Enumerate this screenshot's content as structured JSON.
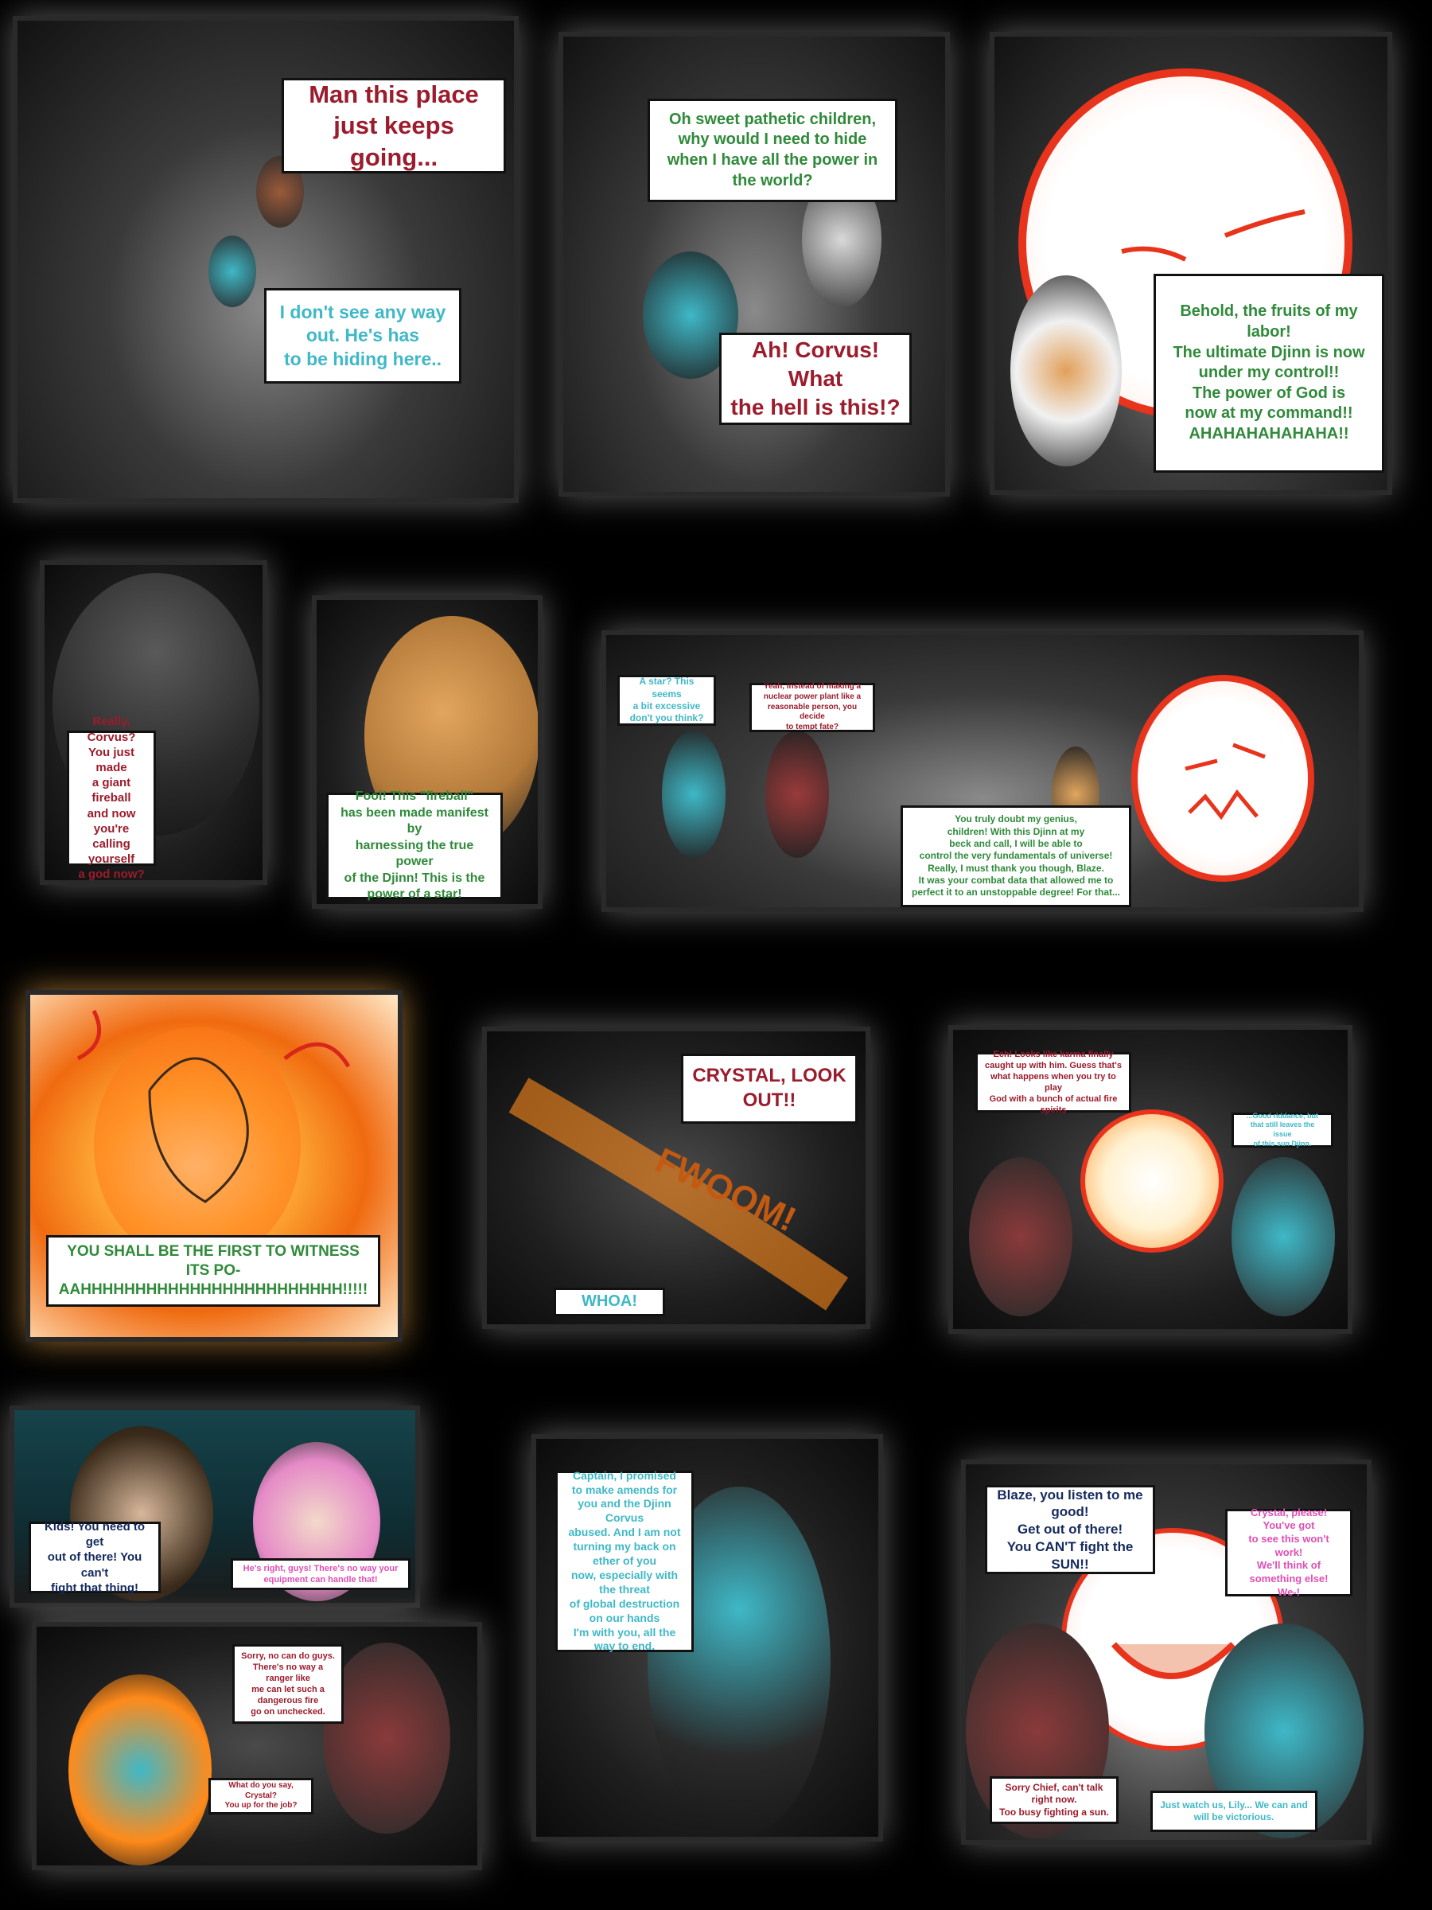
{
  "panels": {
    "p1": {
      "bubble_a": "Man this place\njust keeps going...",
      "bubble_b": "I don't see any way\nout. He's has\nto be hiding here.."
    },
    "p2": {
      "bubble_a": "Oh sweet pathetic children,\nwhy would I need to hide\nwhen I have all the power in the world?",
      "bubble_b": "Ah! Corvus! What\nthe hell is this!?"
    },
    "p3": {
      "bubble_a": "Behold, the fruits of my labor!\nThe ultimate Djinn is now\nunder my control!!\nThe power of God is\nnow at my command!!\nAHAHAHAHAHAHA!!"
    },
    "p4": {
      "bubble_a": "Really, Corvus?\nYou just made\na giant fireball\nand now you're\ncalling yourself\na god now?"
    },
    "p5": {
      "bubble_a": "Fool! This \"fireball\"\nhas been made manifest by\nharnessing the true power\nof the Djinn! This is the\npower of a star!"
    },
    "p6": {
      "bubble_a": "A star? This seems\na bit excessive\ndon't you think?",
      "bubble_b": "Yeah, instead of making a\nnuclear power plant like a\nreasonable person, you decide\nto tempt fate?",
      "bubble_c": "You truly doubt my genius,\nchildren! With this Djinn at my\nbeck and call, I will be able to\ncontrol the very fundamentals of universe!\nReally, I must thank you though, Blaze.\nIt was your combat data that allowed me to\nperfect it to an unstoppable degree! For that..."
    },
    "p7": {
      "bubble_a": "YOU SHALL BE THE FIRST TO WITNESS ITS PO-\nAAHHHHHHHHHHHHHHHHHHHHHHHH!!!!!"
    },
    "p8": {
      "bubble_a": "CRYSTAL, LOOK OUT!!",
      "bubble_b": "WHOA!",
      "sfx": "FWOOM!"
    },
    "p9": {
      "bubble_a": "Ech! Looks like karma finally\ncaught up with him. Guess that's\nwhat happens when you try to play\nGod with a bunch of actual fire spirits",
      "bubble_b": "...Good riddance, but\nthat still leaves the issue\nof this sun Djinn."
    },
    "p10": {
      "bubble_a": "Kids! You need to get\nout of there! You can't\nfight that thing!",
      "bubble_b": "He's right, guys! There's no way your\nequipment can handle that!"
    },
    "p11": {
      "bubble_a": "Sorry, no can do guys.\nThere's no way a ranger like\nme can let such a dangerous fire\ngo on unchecked.",
      "bubble_b": "What do you say, Crystal?\nYou up for the job?"
    },
    "p12": {
      "bubble_a": "Captain, I promised\nto make amends for\nyou and the Djinn Corvus\nabused. And I am not\nturning my back on ether of you\nnow, especially with the threat\nof global destruction on our hands\nI'm with you, all the way to end."
    },
    "p13": {
      "bubble_a": "Blaze, you listen to me good!\nGet out of there!\nYou CAN'T fight the SUN!!",
      "bubble_b": "Crystal, please! You've got\nto see this won't work!\nWe'll think of something else!\nWe-!",
      "bubble_c": "Sorry Chief, can't talk right now.\nToo busy fighting a sun.",
      "bubble_d": "Just watch us, Lily... We can and\nwill be victorious."
    }
  },
  "colors": {
    "red_text": "#9b1c2c",
    "teal_text": "#3fb8c7",
    "green_text": "#2f8a3a",
    "navy_text": "#142a5e",
    "pink_text": "#e04fb4",
    "sun_outline": "#e8341c"
  }
}
